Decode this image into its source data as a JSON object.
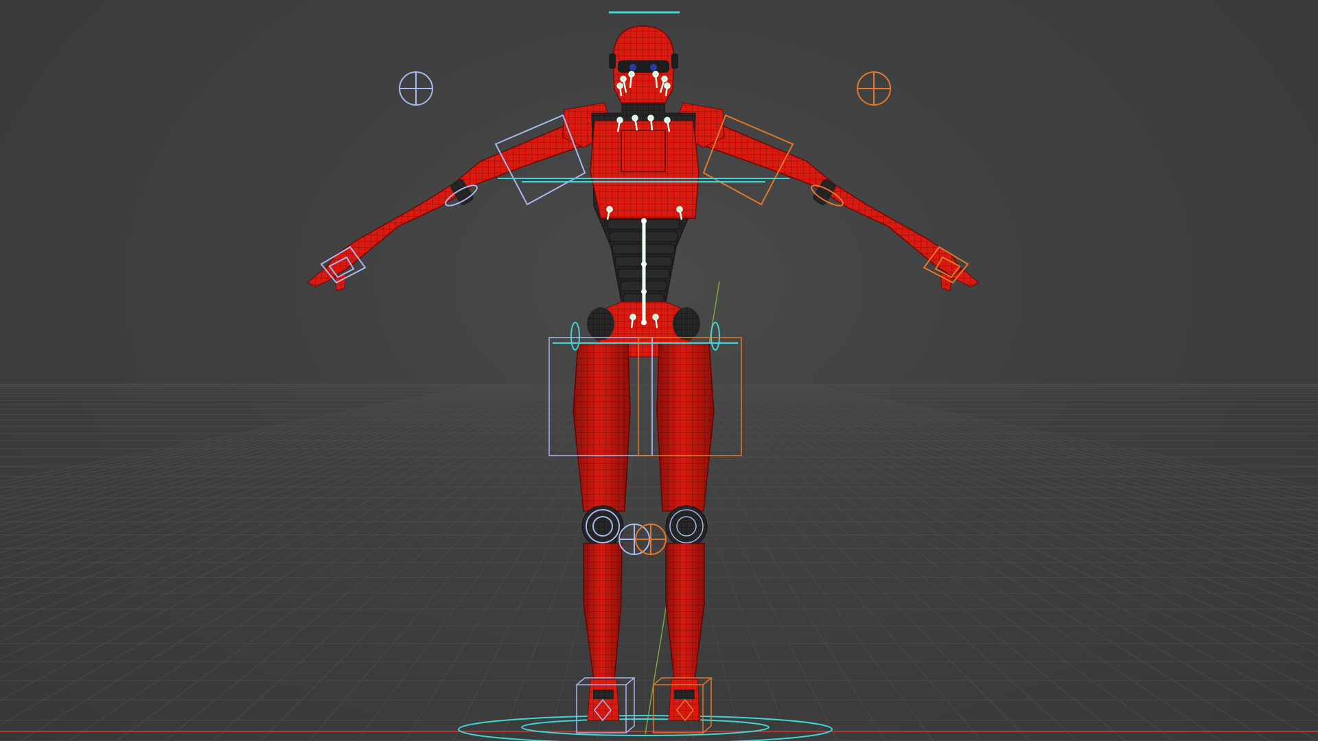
{
  "app": {
    "title": ""
  },
  "viewport": {
    "background": "#404040",
    "grid_color": "#4d4d4d",
    "axis_x_color": "#b03a3a",
    "axis_y_color": "#8bbf3a",
    "shading": "solid-wireframe"
  },
  "model": {
    "name": "",
    "body_color": "#d81a10",
    "joint_color": "#222222",
    "wire_color": "#7a0c08"
  },
  "rig": {
    "left_control_color": "#a9b8ee",
    "right_control_color": "#e5782a",
    "center_control_color": "#3fd6d6",
    "bone_color": "#e8fff0"
  }
}
